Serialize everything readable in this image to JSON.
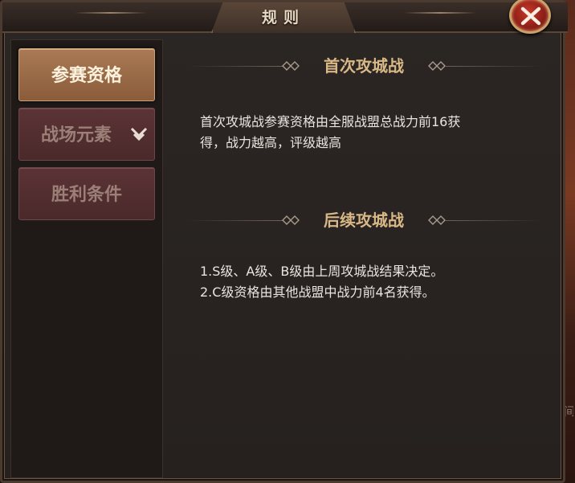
{
  "window": {
    "title": "规则"
  },
  "colors": {
    "active_tab": "#9a6b47",
    "inactive_tab": "#532e31",
    "heading": "#d9b887",
    "close_red": "#b12b20"
  },
  "sidebar": {
    "tabs": [
      {
        "label": "参赛资格",
        "active": true
      },
      {
        "label": "战场元素",
        "active": false,
        "icon": "chevron-down-icon"
      },
      {
        "label": "胜利条件",
        "active": false
      }
    ]
  },
  "main": {
    "sections": [
      {
        "heading": "首次攻城战",
        "lines": [
          "首次攻城战参赛资格由全服战盟总战力前16获",
          "得，战力越高，评级越高"
        ]
      },
      {
        "heading": "后续攻城战",
        "lines": [
          "1.S级、A级、B级由上周攻城战结果决定。",
          "2.C级资格由其他战盟中战力前4名获得。"
        ]
      }
    ]
  },
  "background_fragment": "间"
}
